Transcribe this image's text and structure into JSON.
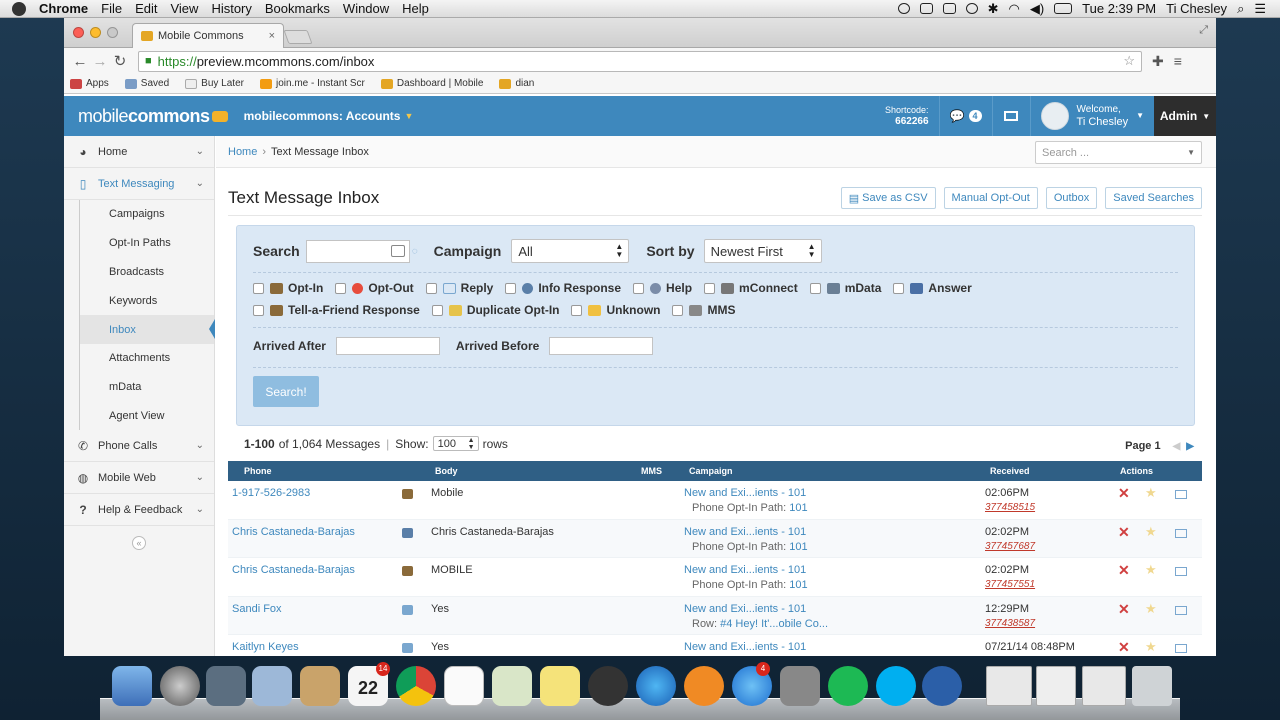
{
  "menubar": {
    "app": "Chrome",
    "items": [
      "File",
      "Edit",
      "View",
      "History",
      "Bookmarks",
      "Window",
      "Help"
    ],
    "clock": "Tue 2:39 PM",
    "user": "Ti Chesley"
  },
  "browser": {
    "tab_title": "Mobile Commons",
    "url_https": "https://",
    "url_rest": "preview.mcommons.com/inbox",
    "bookmarks": [
      "Apps",
      "Saved",
      "Buy Later",
      "join.me - Instant Scr",
      "Dashboard | Mobile",
      "dian"
    ]
  },
  "app": {
    "logo_light": "mobile",
    "logo_bold": "commons",
    "account": "mobilecommons: Accounts",
    "shortcode_label": "Shortcode:",
    "shortcode_value": "662266",
    "message_count": "4",
    "welcome": "Welcome,",
    "user_name": "Ti Chesley",
    "admin": "Admin"
  },
  "sidebar": {
    "home": "Home",
    "text_messaging": "Text Messaging",
    "sub": [
      "Campaigns",
      "Opt-In Paths",
      "Broadcasts",
      "Keywords",
      "Inbox",
      "Attachments",
      "mData",
      "Agent View"
    ],
    "phone_calls": "Phone Calls",
    "mobile_web": "Mobile Web",
    "help": "Help & Feedback"
  },
  "main": {
    "breadcrumb_home": "Home",
    "breadcrumb_current": "Text Message Inbox",
    "search_placeholder": "Search ...",
    "title": "Text Message Inbox",
    "actions": [
      "Save as CSV",
      "Manual Opt-Out",
      "Outbox",
      "Saved Searches"
    ],
    "filters": {
      "search_label": "Search",
      "campaign_label": "Campaign",
      "campaign_value": "All",
      "sort_label": "Sort by",
      "sort_value": "Newest First",
      "types_row1": [
        "Opt-In",
        "Opt-Out",
        "Reply",
        "Info Response",
        "Help",
        "mConnect",
        "mData",
        "Answer"
      ],
      "types_row2": [
        "Tell-a-Friend Response",
        "Duplicate Opt-In",
        "Unknown",
        "MMS"
      ],
      "arrived_after": "Arrived After",
      "arrived_before": "Arrived Before",
      "search_button": "Search!"
    },
    "summary": {
      "range": "1-100",
      "of_text": "of 1,064 Messages",
      "show_label": "Show:",
      "show_value": "100",
      "rows_label": "rows",
      "page": "Page 1"
    },
    "columns": [
      "Phone",
      "Body",
      "MMS",
      "Campaign",
      "Received",
      "Actions"
    ],
    "rows": [
      {
        "phone": "1-917-526-2983",
        "body": "Mobile",
        "campaign": "New and Exi...ients - 101",
        "sub_label": "Phone Opt-In Path:",
        "sub_value": "101",
        "time": "02:06PM",
        "id": "377458515",
        "icon_color": "#8a6a3a"
      },
      {
        "phone": "Chris Castaneda-Barajas",
        "body": "Chris Castaneda-Barajas",
        "campaign": "New and Exi...ients - 101",
        "sub_label": "Phone Opt-In Path:",
        "sub_value": "101",
        "time": "02:02PM",
        "id": "377457687",
        "icon_color": "#5a7fa8"
      },
      {
        "phone": "Chris Castaneda-Barajas",
        "body": "MOBILE",
        "campaign": "New and Exi...ients - 101",
        "sub_label": "Phone Opt-In Path:",
        "sub_value": "101",
        "time": "02:02PM",
        "id": "377457551",
        "icon_color": "#8a6a3a"
      },
      {
        "phone": "Sandi Fox",
        "body": "Yes",
        "campaign": "New and Exi...ients - 101",
        "sub_label": "Row:",
        "sub_value": "#4 Hey! It'...obile Co...",
        "time": "12:29PM",
        "id": "377438587",
        "icon_color": "#7aa7cf"
      },
      {
        "phone": "Kaitlyn Keyes",
        "body": "Yes",
        "campaign": "New and Exi...ients - 101",
        "sub_label": "",
        "sub_value": "",
        "time": "07/21/14 08:48PM",
        "id": "",
        "icon_color": "#7aa7cf"
      }
    ]
  },
  "dock": {
    "calendar_day": "22",
    "calendar_month": "JUL",
    "calendar_badge": "14",
    "appstore_badge": "4"
  }
}
